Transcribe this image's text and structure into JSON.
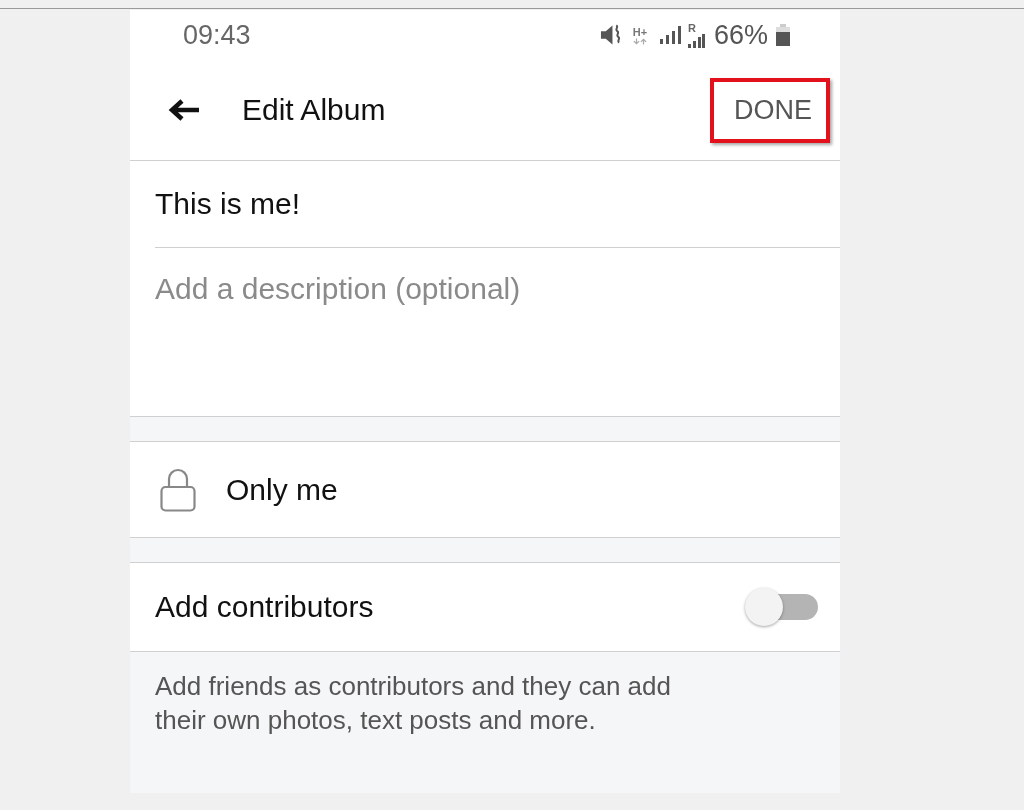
{
  "status_bar": {
    "time": "09:43",
    "network_type": "H+",
    "roaming_mark": "R",
    "battery": "66%"
  },
  "header": {
    "title": "Edit Album",
    "done_button": {
      "label": "DONE",
      "highlighted": true
    }
  },
  "album_name": {
    "value": "This is me!"
  },
  "description": {
    "placeholder": "Add a description (optional)"
  },
  "privacy": {
    "label": "Only me"
  },
  "contributors": {
    "label": "Add contributors",
    "on": false,
    "help_text": "Add friends as contributors and they can add their own photos, text posts and more."
  }
}
